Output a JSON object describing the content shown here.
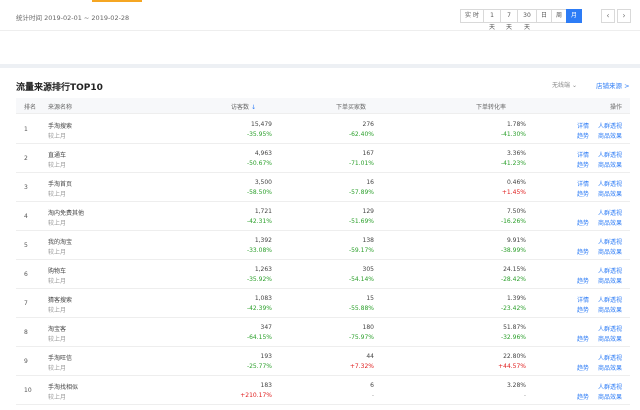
{
  "top": {
    "date_label": "统计时间 2019-02-01 ~ 2019-02-28",
    "periods": [
      "实 时",
      "1天",
      "7天",
      "30天",
      "日",
      "周",
      "月"
    ],
    "active_period": "月",
    "prev_icon": "chevron-left-icon",
    "next_icon": "chevron-right-icon"
  },
  "main": {
    "title": "流量来源排行TOP10",
    "dropdown": "无线端",
    "source_link": "店铺来源 >",
    "columns": {
      "rank": "排名",
      "source": "来源名称",
      "visitors": "访客数",
      "buyers": "下单买家数",
      "conversion": "下单转化率",
      "actions": "操作"
    },
    "compare_label": "较上月",
    "rows": [
      {
        "rank": "1",
        "name": "手淘搜索",
        "visitors": "15,479",
        "visitors_chg": "-35.95%",
        "buyers": "276",
        "buyers_chg": "-62.40%",
        "conv": "1.78%",
        "conv_chg": "-41.30%",
        "links": [
          "详情",
          "趋势"
        ],
        "links2": [
          "人群透视",
          "商品效果"
        ]
      },
      {
        "rank": "2",
        "name": "直通车",
        "visitors": "4,963",
        "visitors_chg": "-50.67%",
        "buyers": "167",
        "buyers_chg": "-71.01%",
        "conv": "3.36%",
        "conv_chg": "-41.23%",
        "links": [
          "详情",
          "趋势"
        ],
        "links2": [
          "人群透视",
          "商品效果"
        ]
      },
      {
        "rank": "3",
        "name": "手淘首页",
        "visitors": "3,500",
        "visitors_chg": "-58.50%",
        "buyers": "16",
        "buyers_chg": "-57.89%",
        "conv": "0.46%",
        "conv_chg": "+1.45%",
        "links": [
          "详情",
          "趋势"
        ],
        "links2": [
          "人群透视",
          "商品效果"
        ]
      },
      {
        "rank": "4",
        "name": "淘内免费其他",
        "visitors": "1,721",
        "visitors_chg": "-42.31%",
        "buyers": "129",
        "buyers_chg": "-51.69%",
        "conv": "7.50%",
        "conv_chg": "-16.26%",
        "links": [
          "",
          "趋势"
        ],
        "links2": [
          "人群透视",
          "商品效果"
        ]
      },
      {
        "rank": "5",
        "name": "我的淘宝",
        "visitors": "1,392",
        "visitors_chg": "-33.08%",
        "buyers": "138",
        "buyers_chg": "-59.17%",
        "conv": "9.91%",
        "conv_chg": "-38.99%",
        "links": [
          "",
          "趋势"
        ],
        "links2": [
          "人群透视",
          "商品效果"
        ]
      },
      {
        "rank": "6",
        "name": "购物车",
        "visitors": "1,263",
        "visitors_chg": "-35.92%",
        "buyers": "305",
        "buyers_chg": "-54.14%",
        "conv": "24.15%",
        "conv_chg": "-28.42%",
        "links": [
          "",
          "趋势"
        ],
        "links2": [
          "人群透视",
          "商品效果"
        ]
      },
      {
        "rank": "7",
        "name": "猜客搜索",
        "visitors": "1,083",
        "visitors_chg": "-42.39%",
        "buyers": "15",
        "buyers_chg": "-55.88%",
        "conv": "1.39%",
        "conv_chg": "-23.42%",
        "links": [
          "详情",
          "趋势"
        ],
        "links2": [
          "人群透视",
          "商品效果"
        ]
      },
      {
        "rank": "8",
        "name": "淘宝客",
        "visitors": "347",
        "visitors_chg": "-64.15%",
        "buyers": "180",
        "buyers_chg": "-75.97%",
        "conv": "51.87%",
        "conv_chg": "-32.96%",
        "links": [
          "",
          "趋势"
        ],
        "links2": [
          "人群透视",
          "商品效果"
        ]
      },
      {
        "rank": "9",
        "name": "手淘旺信",
        "visitors": "193",
        "visitors_chg": "-25.77%",
        "buyers": "44",
        "buyers_chg": "+7.32%",
        "conv": "22.80%",
        "conv_chg": "+44.57%",
        "links": [
          "",
          "趋势"
        ],
        "links2": [
          "人群透视",
          "商品效果"
        ]
      },
      {
        "rank": "10",
        "name": "手淘找相似",
        "visitors": "183",
        "visitors_chg": "+210.17%",
        "buyers": "6",
        "buyers_chg": "-",
        "conv": "3.28%",
        "conv_chg": "-",
        "links": [
          "",
          "趋势"
        ],
        "links2": [
          "人群透视",
          "商品效果"
        ]
      }
    ]
  }
}
